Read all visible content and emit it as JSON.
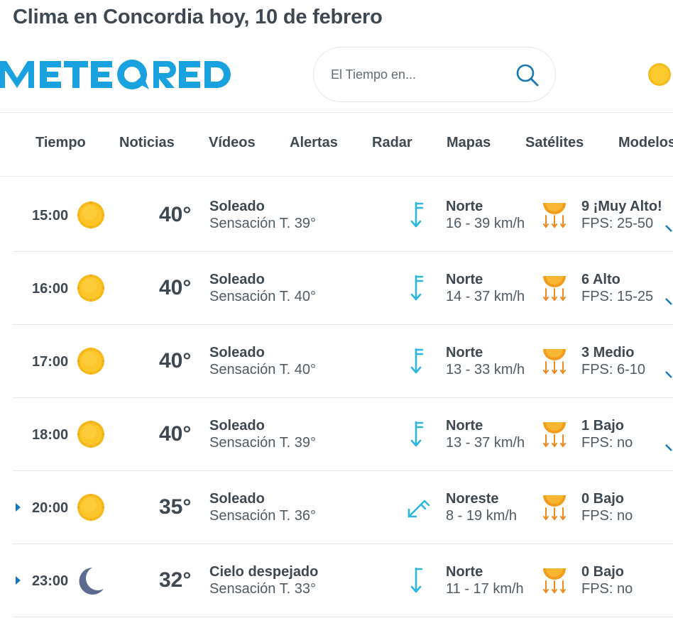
{
  "page_title": "Clima en Concordia hoy, 10 de febrero",
  "brand": "METEORED",
  "search": {
    "placeholder": "El Tiempo en..."
  },
  "colors": {
    "brand_blue": "#1aa1e0",
    "text": "#3d4852",
    "wind": "#2bb6e0",
    "sun": "#f6b81a",
    "moon": "#5c6a8e"
  },
  "nav": [
    "Tiempo",
    "Noticias",
    "Vídeos",
    "Alertas",
    "Radar",
    "Mapas",
    "Satélites",
    "Modelos"
  ],
  "rows": [
    {
      "hour": "15:00",
      "icon": "sun-icon",
      "temp": "40°",
      "condition": "Soleado",
      "feels": "Sensación T. 39°",
      "wind_icon": "wind-north-icon",
      "wind_dir": "Norte",
      "wind_speed": "16 - 39 km/h",
      "uv": "9 ¡Muy Alto!",
      "fps": "FPS: 25-50",
      "expandable": false
    },
    {
      "hour": "16:00",
      "icon": "sun-icon",
      "temp": "40°",
      "condition": "Soleado",
      "feels": "Sensación T. 40°",
      "wind_icon": "wind-north-icon",
      "wind_dir": "Norte",
      "wind_speed": "14 - 37 km/h",
      "uv": "6 Alto",
      "fps": "FPS: 15-25",
      "expandable": false
    },
    {
      "hour": "17:00",
      "icon": "sun-icon",
      "temp": "40°",
      "condition": "Soleado",
      "feels": "Sensación T. 40°",
      "wind_icon": "wind-north-icon",
      "wind_dir": "Norte",
      "wind_speed": "13 - 33 km/h",
      "uv": "3 Medio",
      "fps": "FPS: 6-10",
      "expandable": false
    },
    {
      "hour": "18:00",
      "icon": "sun-icon",
      "temp": "40°",
      "condition": "Soleado",
      "feels": "Sensación T. 39°",
      "wind_icon": "wind-north-icon",
      "wind_dir": "Norte",
      "wind_speed": "13 - 37 km/h",
      "uv": "1 Bajo",
      "fps": "FPS: no",
      "expandable": false
    },
    {
      "hour": "20:00",
      "icon": "sun-icon",
      "temp": "35°",
      "condition": "Soleado",
      "feels": "Sensación T. 36°",
      "wind_icon": "wind-northeast-icon",
      "wind_dir": "Noreste",
      "wind_speed": "8 - 19 km/h",
      "uv": "0 Bajo",
      "fps": "FPS: no",
      "expandable": true
    },
    {
      "hour": "23:00",
      "icon": "moon-icon",
      "temp": "32°",
      "condition": "Cielo despejado",
      "feels": "Sensación T. 33°",
      "wind_icon": "wind-north-icon",
      "wind_dir": "Norte",
      "wind_speed": "11 - 17 km/h",
      "uv": "0 Bajo",
      "fps": "FPS: no",
      "expandable": true
    }
  ]
}
